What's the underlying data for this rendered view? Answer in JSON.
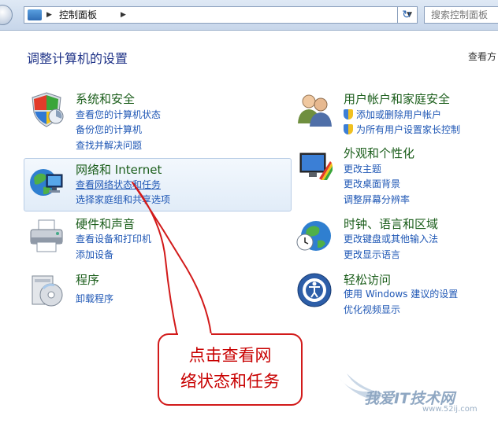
{
  "address_bar": {
    "path": "控制面板",
    "search_placeholder": "搜索控制面板"
  },
  "header": {
    "title": "调整计算机的设置",
    "view_by": "查看方"
  },
  "categories": {
    "system": {
      "title": "系统和安全",
      "links": [
        "查看您的计算机状态",
        "备份您的计算机",
        "查找并解决问题"
      ]
    },
    "network": {
      "title": "网络和 Internet",
      "links": [
        "查看网络状态和任务",
        "选择家庭组和共享选项"
      ]
    },
    "hardware": {
      "title": "硬件和声音",
      "links": [
        "查看设备和打印机",
        "添加设备"
      ]
    },
    "programs": {
      "title": "程序",
      "links": [
        "卸载程序"
      ]
    },
    "user": {
      "title": "用户帐户和家庭安全",
      "links": [
        "添加或删除用户帐户",
        "为所有用户设置家长控制"
      ]
    },
    "appearance": {
      "title": "外观和个性化",
      "links": [
        "更改主题",
        "更改桌面背景",
        "调整屏幕分辨率"
      ]
    },
    "clock": {
      "title": "时钟、语言和区域",
      "links": [
        "更改键盘或其他输入法",
        "更改显示语言"
      ]
    },
    "ease": {
      "title": "轻松访问",
      "links": [
        "使用 Windows 建议的设置",
        "优化视频显示"
      ]
    }
  },
  "callout": {
    "line1": "点击查看网",
    "line2": "络状态和任务"
  },
  "watermark": {
    "main": "我爱IT技术网",
    "sub": "www.52ij.com"
  },
  "colors": {
    "title_green": "#1a5d1a",
    "link_blue": "#1f57b5",
    "callout_red": "#d21a1a"
  }
}
